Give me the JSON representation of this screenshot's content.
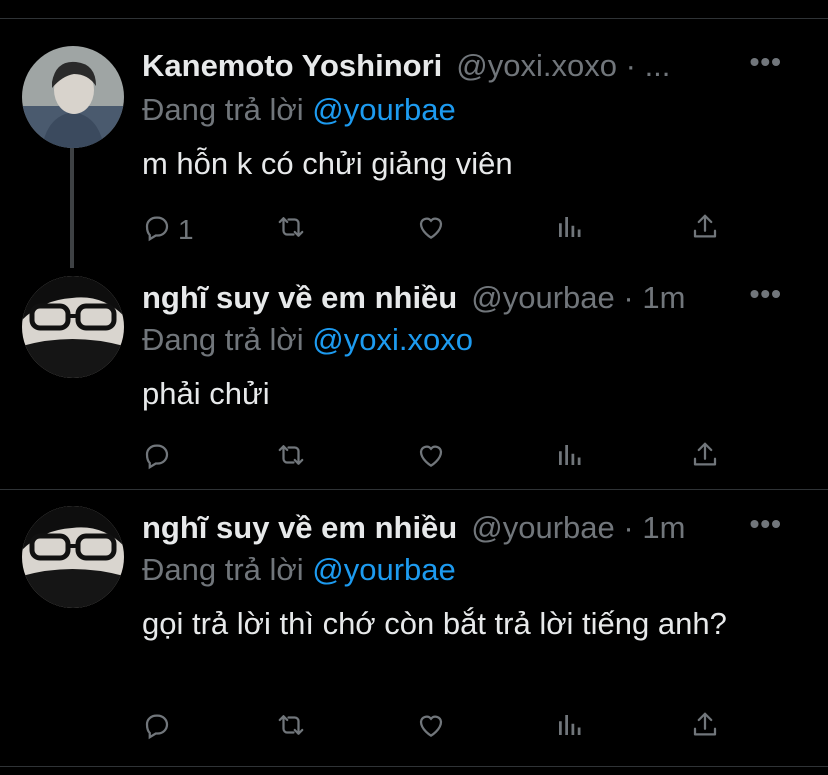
{
  "tweets": [
    {
      "name": "Kanemoto Yoshinori",
      "handle": "@yoxi.xoxo",
      "sep": "·",
      "time": "...",
      "more": "•••",
      "reply_prefix": "Đang trả lời",
      "reply_to": "@yourbae",
      "text": "m hỗn k có chửi giảng viên",
      "reply_count": "1",
      "avatar": "avatar-kanemoto"
    },
    {
      "name": "nghĩ suy về em nhiều",
      "handle": "@yourbae",
      "sep": "·",
      "time": "1m",
      "more": "•••",
      "reply_prefix": "Đang trả lời",
      "reply_to": "@yoxi.xoxo",
      "text": "phải chửi",
      "reply_count": "",
      "avatar": "avatar-yourbae"
    },
    {
      "name": "nghĩ suy về em nhiều",
      "handle": "@yourbae",
      "sep": "·",
      "time": "1m",
      "more": "•••",
      "reply_prefix": "Đang trả lời",
      "reply_to": "@yourbae",
      "text": "gọi trả lời thì chớ còn bắt trả lời tiếng anh?",
      "reply_count": "",
      "avatar": "avatar-yourbae"
    }
  ],
  "colors": {
    "background": "#000000",
    "text": "#e7e9ea",
    "secondary": "#71767b",
    "accent": "#1d9bf0",
    "divider": "#2f3336"
  },
  "icons": [
    "reply-icon",
    "retweet-icon",
    "like-icon",
    "analytics-icon",
    "share-icon",
    "more-icon"
  ]
}
